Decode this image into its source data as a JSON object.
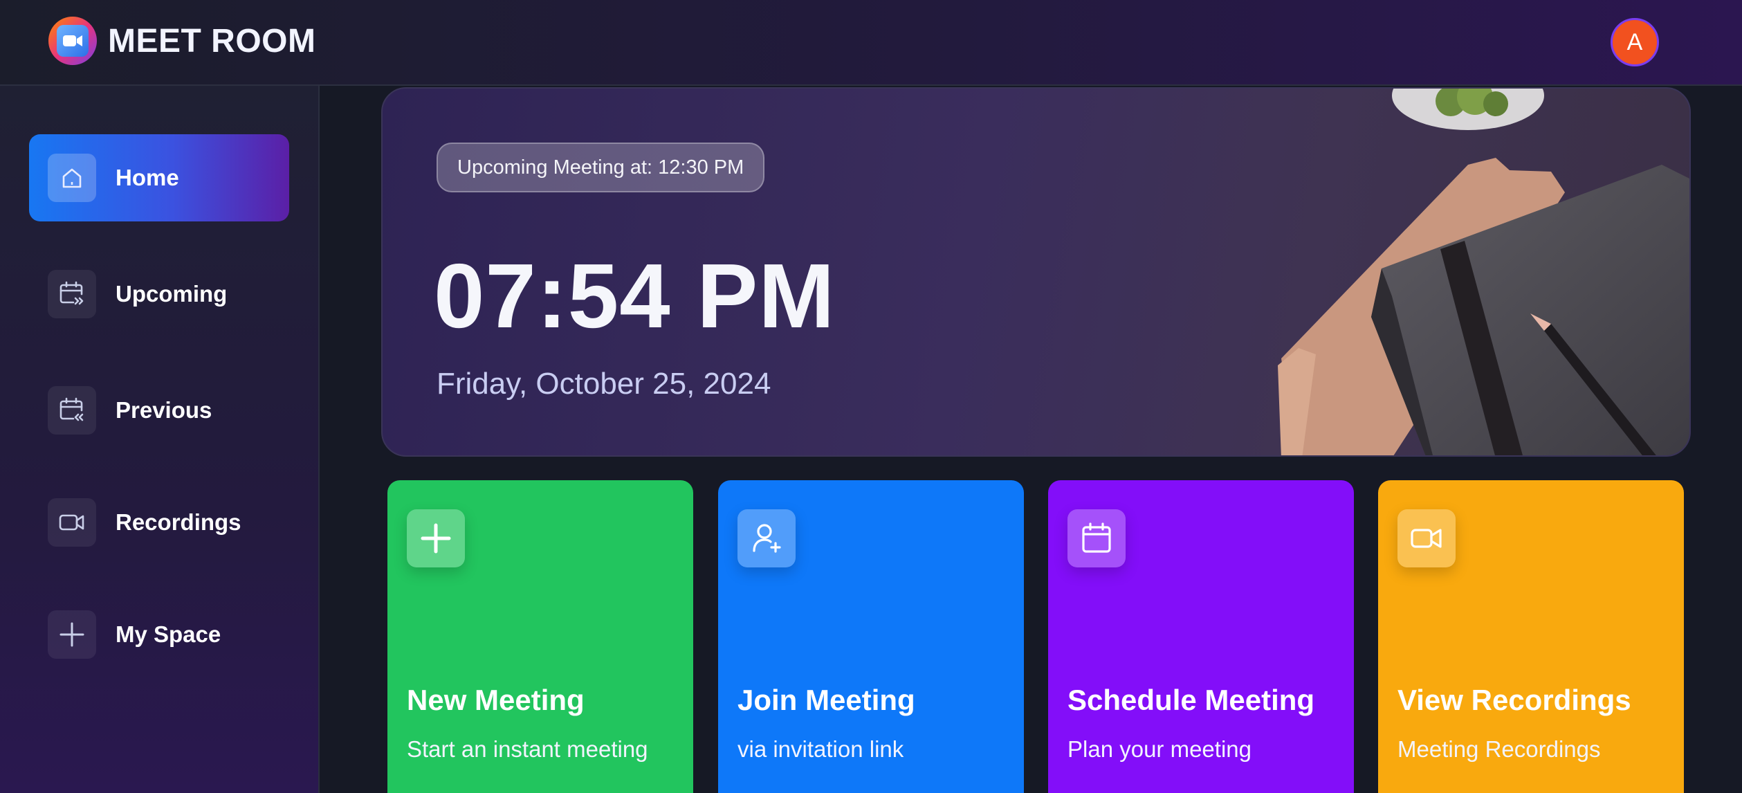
{
  "app": {
    "title": "MEET ROOM",
    "avatar_initial": "A"
  },
  "sidebar": {
    "items": [
      {
        "label": "Home",
        "icon": "home-icon",
        "active": true
      },
      {
        "label": "Upcoming",
        "icon": "calendar-forward-icon",
        "active": false
      },
      {
        "label": "Previous",
        "icon": "calendar-back-icon",
        "active": false
      },
      {
        "label": "Recordings",
        "icon": "video-icon",
        "active": false
      },
      {
        "label": "My Space",
        "icon": "plus-icon",
        "active": false
      }
    ]
  },
  "hero": {
    "badge": "Upcoming Meeting at: 12:30 PM",
    "time": "07:54 PM",
    "date": "Friday, October 25, 2024"
  },
  "cards": [
    {
      "title": "New Meeting",
      "subtitle": "Start an instant meeting",
      "icon": "plus-icon",
      "color": "#22c55e"
    },
    {
      "title": "Join Meeting",
      "subtitle": "via invitation link",
      "icon": "user-plus-icon",
      "color": "#0e78f9"
    },
    {
      "title": "Schedule Meeting",
      "subtitle": "Plan your meeting",
      "icon": "calendar-icon",
      "color": "#830ef9"
    },
    {
      "title": "View Recordings",
      "subtitle": "Meeting Recordings",
      "icon": "video-icon",
      "color": "#f9a90e"
    }
  ],
  "colors": {
    "accent": "#1877f2",
    "avatar": "#f2511f",
    "background": "#161925"
  }
}
